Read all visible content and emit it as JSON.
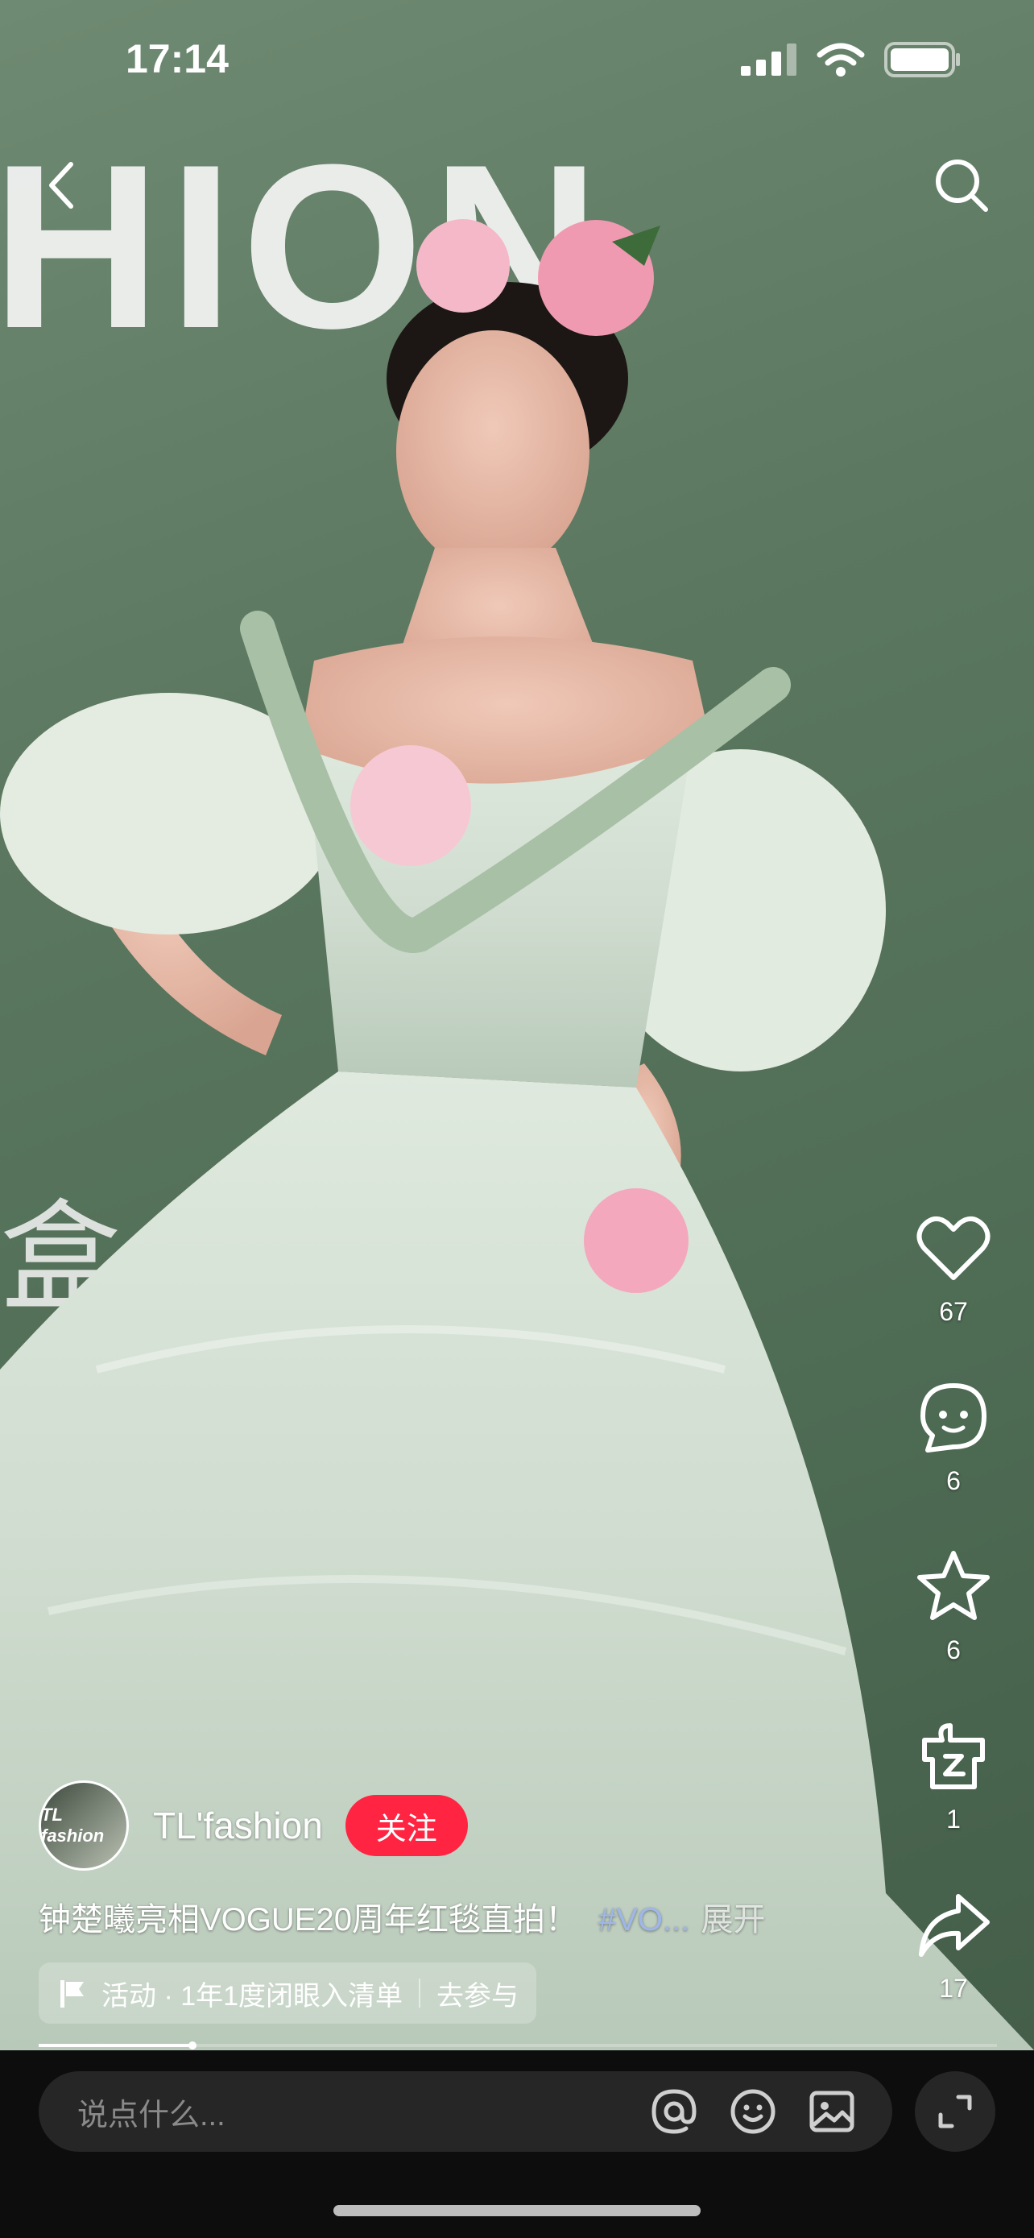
{
  "status_bar": {
    "time": "17:14"
  },
  "backdrop": {
    "word": "HION",
    "glyph": "盒"
  },
  "actions": [
    {
      "name": "like",
      "icon": "heart-icon",
      "count": "67"
    },
    {
      "name": "comment",
      "icon": "comment-icon",
      "count": "6"
    },
    {
      "name": "collect",
      "icon": "star-icon",
      "count": "6"
    },
    {
      "name": "gift",
      "icon": "gift-icon",
      "count": "1"
    },
    {
      "name": "share",
      "icon": "share-icon",
      "count": "17"
    }
  ],
  "author": {
    "avatar_text": "TL fashion",
    "name": "TL'fashion",
    "follow_label": "关注"
  },
  "caption": {
    "text": "钟楚曦亮相VOGUE20周年红毯直拍！",
    "tag": "#VO...",
    "expand": "展开"
  },
  "activity": {
    "label": "活动 · 1年1度闭眼入清单",
    "action": "去参与"
  },
  "progress": {
    "fraction": 0.16
  },
  "comment_bar": {
    "placeholder": "说点什么..."
  },
  "colors": {
    "accent": "#ff2442",
    "tag": "#9fb7e8",
    "bar": "#0d0d0d"
  }
}
